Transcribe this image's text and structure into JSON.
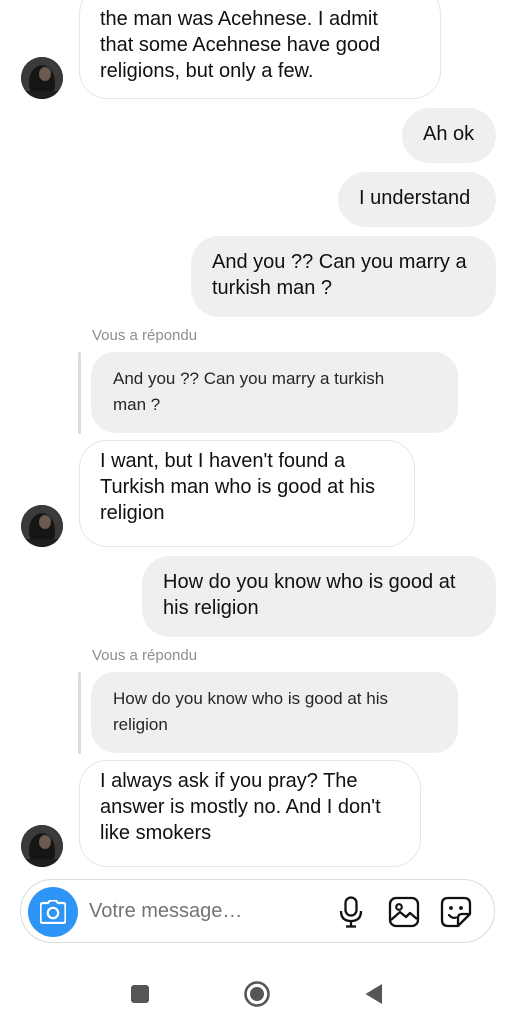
{
  "messages": [
    {
      "kind": "incoming",
      "text": "the man was Acehnese.  I admit\nthat some Acehnese have good\nreligions, but only a few."
    },
    {
      "kind": "outgoing",
      "text": "Ah ok"
    },
    {
      "kind": "outgoing",
      "text": "I understand"
    },
    {
      "kind": "outgoing",
      "text": "And you ?? Can you marry a\nturkish man ?"
    },
    {
      "kind": "reply",
      "label": "Vous a répondu",
      "quote": "And you ?? Can you marry a turkish\nman ?"
    },
    {
      "kind": "incoming",
      "text": "I want, but I haven't found a\nTurkish man who is good at his\nreligion"
    },
    {
      "kind": "outgoing",
      "text": "How do you know who is good at\nhis religion"
    },
    {
      "kind": "reply",
      "label": "Vous a répondu",
      "quote": "How do you know who is good at his\nreligion"
    },
    {
      "kind": "incoming",
      "text": "I always ask if you pray? The\nanswer is mostly no. And I don't\nlike smokers"
    }
  ],
  "composer": {
    "placeholder": "Votre message…",
    "camera_icon": "camera-icon",
    "mic_icon": "microphone-icon",
    "gallery_icon": "image-icon",
    "sticker_icon": "sticker-icon",
    "accent_color": "#2e95f6"
  },
  "navbar": {
    "recents_icon": "square-icon",
    "home_icon": "circle-icon",
    "back_icon": "triangle-back-icon"
  }
}
